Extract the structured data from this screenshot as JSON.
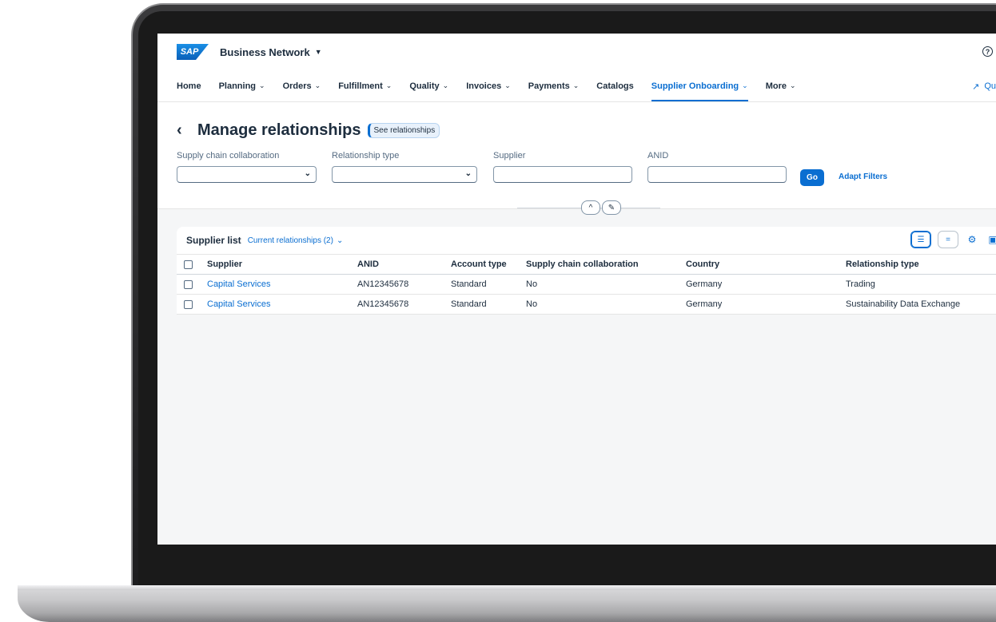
{
  "shell": {
    "logo_text": "SAP",
    "brand": "Business Network",
    "brand_caret": "▼",
    "help_glyph": "?"
  },
  "nav": {
    "items": [
      {
        "label": "Home",
        "has_menu": false
      },
      {
        "label": "Planning",
        "has_menu": true
      },
      {
        "label": "Orders",
        "has_menu": true
      },
      {
        "label": "Fulfillment",
        "has_menu": true
      },
      {
        "label": "Quality",
        "has_menu": true
      },
      {
        "label": "Invoices",
        "has_menu": true
      },
      {
        "label": "Payments",
        "has_menu": true
      },
      {
        "label": "Catalogs",
        "has_menu": false
      },
      {
        "label": "Supplier Onboarding",
        "has_menu": true,
        "active": true
      },
      {
        "label": "More",
        "has_menu": true
      }
    ],
    "right_label": "Qu",
    "chevron": "⌄"
  },
  "page": {
    "title": "Manage relationships",
    "see_relationships": "See relationships"
  },
  "filters": {
    "supply_chain_label": "Supply chain collaboration",
    "relationship_type_label": "Relationship type",
    "supplier_label": "Supplier",
    "anid_label": "ANID",
    "go_label": "Go",
    "adapt_label": "Adapt Filters"
  },
  "table": {
    "title": "Supplier list",
    "variant": "Current relationships (2)",
    "columns": [
      "Supplier",
      "ANID",
      "Account type",
      "Supply chain collaboration",
      "Country",
      "Relationship type"
    ],
    "rows": [
      [
        "Capital Services",
        "AN12345678",
        "Standard",
        "No",
        "Germany",
        "Trading"
      ],
      [
        "Capital Services",
        "AN12345678",
        "Standard",
        "No",
        "Germany",
        "Sustainability Data Exchange"
      ]
    ]
  },
  "colors": {
    "accent": "#0a6ed1",
    "text": "#1d2d3e",
    "page_bg": "#f5f6f7"
  }
}
